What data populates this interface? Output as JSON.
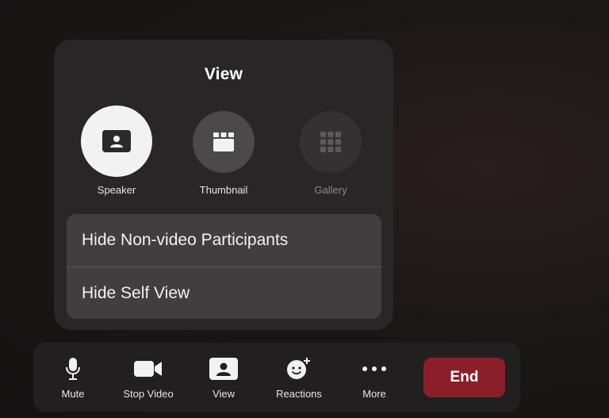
{
  "view_panel": {
    "title": "View",
    "layouts": [
      {
        "label": "Speaker",
        "state": "selected"
      },
      {
        "label": "Thumbnail",
        "state": "available"
      },
      {
        "label": "Gallery",
        "state": "disabled"
      }
    ],
    "options": [
      {
        "label": "Hide Non-video Participants"
      },
      {
        "label": "Hide Self View"
      }
    ]
  },
  "toolbar": {
    "items": [
      {
        "label": "Mute",
        "icon": "microphone-icon"
      },
      {
        "label": "Stop Video",
        "icon": "video-camera-icon"
      },
      {
        "label": "View",
        "icon": "speaker-view-icon"
      },
      {
        "label": "Reactions",
        "icon": "emoji-add-icon"
      },
      {
        "label": "More",
        "icon": "more-dots-icon"
      }
    ],
    "end_label": "End"
  },
  "colors": {
    "end_button": "#8a1f2a",
    "panel_background": "#282626",
    "options_background": "#403e3e",
    "selected_layout": "#f2f2f2"
  }
}
